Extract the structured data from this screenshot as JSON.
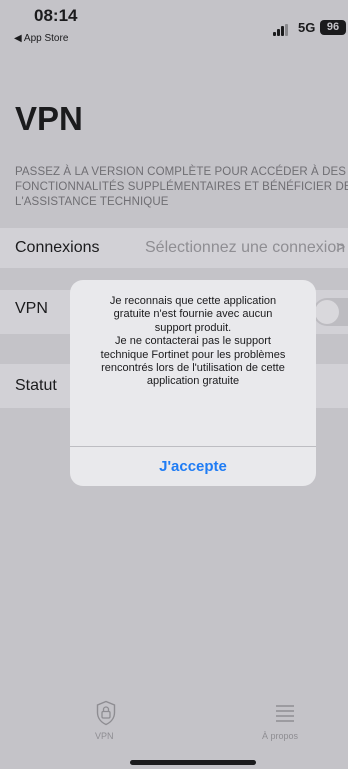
{
  "status_bar": {
    "time": "08:14",
    "back_label": "◀ App Store",
    "network": "5G",
    "battery": "96"
  },
  "page": {
    "title": "VPN",
    "promo": "PASSEZ À LA VERSION COMPLÈTE POUR ACCÉDER À DES FONCTIONNALITÉS SUPPLÉMENTAIRES ET BÉNÉFICIER DE L'ASSISTANCE TECHNIQUE"
  },
  "rows": {
    "connections_label": "Connexions",
    "connections_value": "Sélectionnez une connexion",
    "chevron": ">",
    "vpn_label": "VPN",
    "vpn_toggle_on": false,
    "status_label": "Statut"
  },
  "alert": {
    "line1": "Je reconnais que cette application",
    "line2": "gratuite n'est fournie avec aucun",
    "line3": "support produit.",
    "line4": "Je ne contacterai pas le support",
    "line5": "technique Fortinet pour les problèmes",
    "line6": "rencontrés lors de l'utilisation de cette",
    "line7": "application gratuite",
    "accept_label": "J'accepte"
  },
  "tabbar": {
    "tabs": [
      {
        "label": "VPN",
        "icon": "shield-lock-icon"
      },
      {
        "label": "À propos",
        "icon": "list-icon"
      }
    ]
  },
  "colors": {
    "accent": "#1f7cf4",
    "dim_background": "#c4c3c8"
  }
}
